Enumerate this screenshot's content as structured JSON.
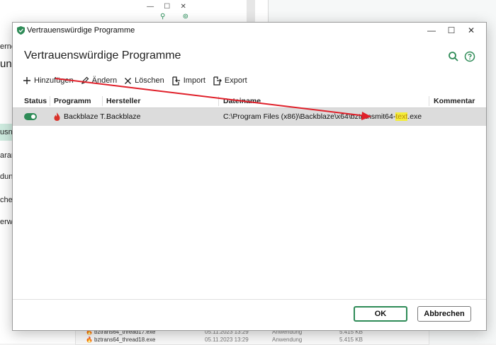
{
  "background": {
    "sidebar_fragments": [
      "erne",
      "usna",
      "aran",
      "dung",
      "che",
      "erwa"
    ],
    "title_fragment": "ung",
    "list_rows": [
      {
        "name": "bztrans64_thread17.exe",
        "date": "05.11.2023 13:29",
        "type": "Anwendung",
        "size": "5.415 KB"
      },
      {
        "name": "bztrans64_thread18.exe",
        "date": "05.11.2023 13:29",
        "type": "Anwendung",
        "size": "5.415 KB"
      }
    ]
  },
  "dialog": {
    "window_title": "Vertrauenswürdige Programme",
    "heading": "Vertrauenswürdige Programme",
    "window_controls": {
      "minimize": "—",
      "maximize": "☐",
      "close": "✕"
    },
    "toolbar": {
      "add": "Hinzufügen",
      "edit": "Ändern",
      "delete": "Löschen",
      "import": "Import",
      "export": "Export"
    },
    "columns": {
      "status": "Status",
      "program": "Programm",
      "vendor": "Hersteller",
      "filename": "Dateiname",
      "comment": "Kommentar"
    },
    "rows": [
      {
        "status": "enabled",
        "program": "Backblaze T...",
        "vendor": "Backblaze",
        "filename_prefix": "C:\\Program Files (x86)\\Backblaze\\x64\\bztransmit64-",
        "filename_highlight": "text",
        "filename_suffix": ".exe",
        "comment": ""
      }
    ],
    "buttons": {
      "ok": "OK",
      "cancel": "Abbrechen"
    }
  },
  "colors": {
    "accent": "#2e8b57",
    "annotation_arrow": "#e0202a",
    "highlight": "#f4ee3a"
  }
}
